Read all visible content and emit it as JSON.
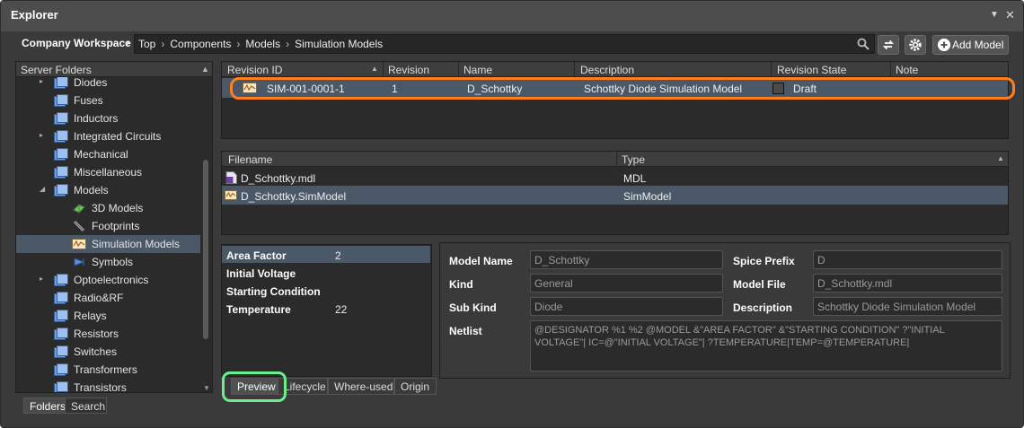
{
  "window": {
    "title": "Explorer"
  },
  "toolbar": {
    "workspace_label": "Company Workspace",
    "breadcrumb": [
      "Top",
      "Components",
      "Models",
      "Simulation Models"
    ],
    "add_model_label": "Add Model"
  },
  "tree": {
    "header": "Server Folders",
    "items": [
      {
        "label": "Diodes",
        "expander": "▸"
      },
      {
        "label": "Fuses",
        "expander": ""
      },
      {
        "label": "Inductors",
        "expander": ""
      },
      {
        "label": "Integrated Circuits",
        "expander": "▸"
      },
      {
        "label": "Mechanical",
        "expander": ""
      },
      {
        "label": "Miscellaneous",
        "expander": ""
      },
      {
        "label": "Models",
        "expander": "◢"
      },
      {
        "label": "3D Models",
        "expander": ""
      },
      {
        "label": "Footprints",
        "expander": ""
      },
      {
        "label": "Simulation Models",
        "expander": ""
      },
      {
        "label": "Symbols",
        "expander": ""
      },
      {
        "label": "Optoelectronics",
        "expander": "▸"
      },
      {
        "label": "Radio&RF",
        "expander": ""
      },
      {
        "label": "Relays",
        "expander": ""
      },
      {
        "label": "Resistors",
        "expander": ""
      },
      {
        "label": "Switches",
        "expander": ""
      },
      {
        "label": "Transformers",
        "expander": ""
      },
      {
        "label": "Transistors",
        "expander": ""
      }
    ],
    "selected": "Simulation Models"
  },
  "left_tabs": {
    "folders": "Folders",
    "search": "Search"
  },
  "revisions": {
    "columns": [
      "Revision ID",
      "Revision",
      "Name",
      "Description",
      "Revision State",
      "Note"
    ],
    "rows": [
      {
        "revision_id": "SIM-001-0001-1",
        "revision": "1",
        "name": "D_Schottky",
        "description": "Schottky Diode Simulation Model",
        "state": "Draft",
        "note": ""
      }
    ]
  },
  "files": {
    "columns": [
      "Filename",
      "Type"
    ],
    "rows": [
      {
        "filename": "D_Schottky.mdl",
        "type": "MDL"
      },
      {
        "filename": "D_Schottky.SimModel",
        "type": "SimModel"
      }
    ]
  },
  "parameters": [
    {
      "name": "Area Factor",
      "value": "2"
    },
    {
      "name": "Initial Voltage",
      "value": ""
    },
    {
      "name": "Starting Condition",
      "value": ""
    },
    {
      "name": "Temperature",
      "value": "22"
    }
  ],
  "details": {
    "model_name_label": "Model Name",
    "model_name": "D_Schottky",
    "spice_prefix_label": "Spice Prefix",
    "spice_prefix": "D",
    "kind_label": "Kind",
    "kind": "General",
    "model_file_label": "Model File",
    "model_file": "D_Schottky.mdl",
    "sub_kind_label": "Sub Kind",
    "sub_kind": "Diode",
    "description_label": "Description",
    "description": "Schottky Diode Simulation Model",
    "netlist_label": "Netlist",
    "netlist": "@DESIGNATOR %1 %2 @MODEL &\"AREA FACTOR\" &\"STARTING CONDITION\" ?\"INITIAL VOLTAGE\"| IC=@\"INITIAL VOLTAGE\"| ?TEMPERATURE|TEMP=@TEMPERATURE|"
  },
  "bottom_tabs": {
    "preview": "Preview",
    "lifecycle": "Lifecycle",
    "where_used": "Where-used",
    "origin": "Origin"
  },
  "colors": {
    "selection": "#4b5867",
    "revision_highlight": "#ff7e1d",
    "preview_highlight": "#68f08a",
    "folder_icon": "#6f9fe0"
  }
}
